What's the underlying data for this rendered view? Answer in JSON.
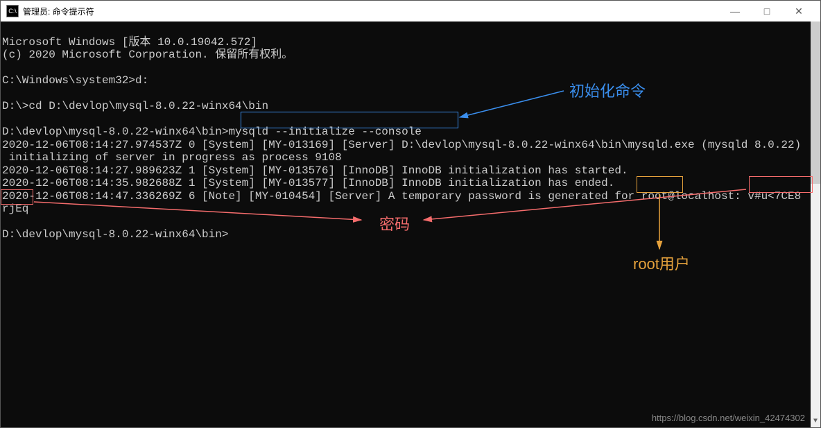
{
  "window": {
    "title_icon": "C:\\",
    "title": "管理员: 命令提示符"
  },
  "terminal": {
    "lines": [
      "Microsoft Windows [版本 10.0.19042.572]",
      "(c) 2020 Microsoft Corporation. 保留所有权利。",
      "",
      "C:\\Windows\\system32>d:",
      "",
      "D:\\>cd D:\\devlop\\mysql-8.0.22-winx64\\bin",
      "",
      "D:\\devlop\\mysql-8.0.22-winx64\\bin>mysqld --initialize --console",
      "2020-12-06T08:14:27.974537Z 0 [System] [MY-013169] [Server] D:\\devlop\\mysql-8.0.22-winx64\\bin\\mysqld.exe (mysqld 8.0.22)",
      " initializing of server in progress as process 9108",
      "2020-12-06T08:14:27.989623Z 1 [System] [MY-013576] [InnoDB] InnoDB initialization has started.",
      "2020-12-06T08:14:35.982688Z 1 [System] [MY-013577] [InnoDB] InnoDB initialization has ended.",
      "2020-12-06T08:14:47.336269Z 6 [Note] [MY-010454] [Server] A temporary password is generated for root@localhost: v#u<7CE8",
      "rjEq",
      "",
      "D:\\devlop\\mysql-8.0.22-winx64\\bin>"
    ]
  },
  "annotations": {
    "init_cmd_label": "初始化命令",
    "password_label": "密码",
    "root_label": "root用户"
  },
  "watermark": "https://blog.csdn.net/weixin_42474302"
}
